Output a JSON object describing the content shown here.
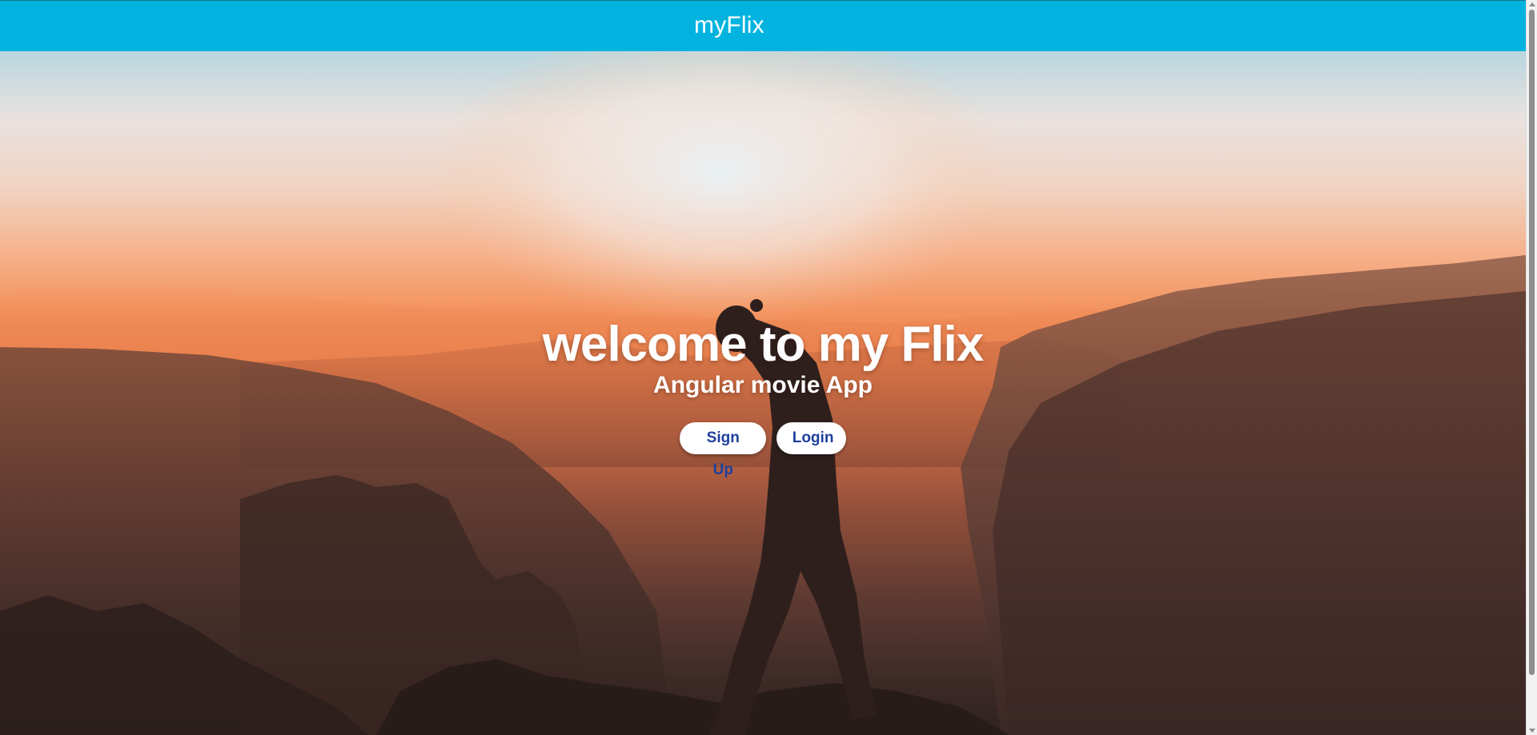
{
  "header": {
    "title": "myFlix",
    "background_color": "#03b3df"
  },
  "hero": {
    "heading": "welcome to my Flix",
    "subheading": "Angular movie App",
    "background_image": "sunset-mountain-silhouette"
  },
  "actions": {
    "signup_label": "Sign Up",
    "login_label": "Login",
    "button_text_color": "#1e3f9c"
  },
  "scrollbar": {
    "up_icon": "scroll-up-arrow-icon",
    "down_icon": "scroll-down-arrow-icon"
  }
}
